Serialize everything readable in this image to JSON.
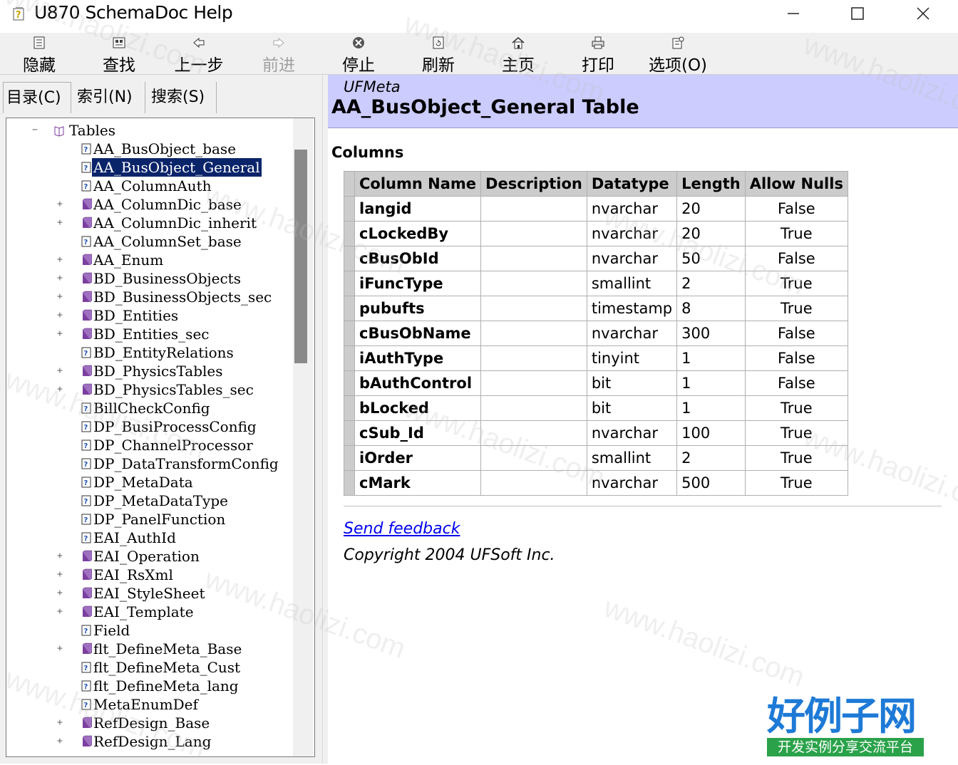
{
  "window": {
    "title": "U870 SchemaDoc Help"
  },
  "toolbar": {
    "items": [
      {
        "label": "隐藏",
        "icon": "hide-icon",
        "enabled": true
      },
      {
        "label": "查找",
        "icon": "find-icon",
        "enabled": true
      },
      {
        "label": "上一步",
        "icon": "back-arrow-icon",
        "enabled": true
      },
      {
        "label": "前进",
        "icon": "forward-arrow-icon",
        "enabled": false
      },
      {
        "label": "停止",
        "icon": "stop-icon",
        "enabled": true
      },
      {
        "label": "刷新",
        "icon": "refresh-icon",
        "enabled": true
      },
      {
        "label": "主页",
        "icon": "home-icon",
        "enabled": true
      },
      {
        "label": "打印",
        "icon": "print-icon",
        "enabled": true
      },
      {
        "label": "选项(O)",
        "icon": "options-icon",
        "enabled": true
      }
    ]
  },
  "nav_tabs": [
    {
      "label": "目录(C)",
      "active": true
    },
    {
      "label": "索引(N)",
      "active": false
    },
    {
      "label": "搜索(S)",
      "active": false
    }
  ],
  "tree": {
    "root": "Tables",
    "items": [
      {
        "label": "AA_BusObject_base",
        "kind": "page",
        "expandable": false,
        "selected": false
      },
      {
        "label": "AA_BusObject_General",
        "kind": "page",
        "expandable": false,
        "selected": true
      },
      {
        "label": "AA_ColumnAuth",
        "kind": "page",
        "expandable": false,
        "selected": false
      },
      {
        "label": "AA_ColumnDic_base",
        "kind": "book",
        "expandable": true,
        "selected": false
      },
      {
        "label": "AA_ColumnDic_inherit",
        "kind": "book",
        "expandable": true,
        "selected": false
      },
      {
        "label": "AA_ColumnSet_base",
        "kind": "page",
        "expandable": false,
        "selected": false
      },
      {
        "label": "AA_Enum",
        "kind": "book",
        "expandable": true,
        "selected": false
      },
      {
        "label": "BD_BusinessObjects",
        "kind": "book",
        "expandable": true,
        "selected": false
      },
      {
        "label": "BD_BusinessObjects_sec",
        "kind": "book",
        "expandable": true,
        "selected": false
      },
      {
        "label": "BD_Entities",
        "kind": "book",
        "expandable": true,
        "selected": false
      },
      {
        "label": "BD_Entities_sec",
        "kind": "book",
        "expandable": true,
        "selected": false
      },
      {
        "label": "BD_EntityRelations",
        "kind": "page",
        "expandable": false,
        "selected": false
      },
      {
        "label": "BD_PhysicsTables",
        "kind": "book",
        "expandable": true,
        "selected": false
      },
      {
        "label": "BD_PhysicsTables_sec",
        "kind": "book",
        "expandable": true,
        "selected": false
      },
      {
        "label": "BillCheckConfig",
        "kind": "page",
        "expandable": false,
        "selected": false
      },
      {
        "label": "DP_BusiProcessConfig",
        "kind": "page",
        "expandable": false,
        "selected": false
      },
      {
        "label": "DP_ChannelProcessor",
        "kind": "page",
        "expandable": false,
        "selected": false
      },
      {
        "label": "DP_DataTransformConfig",
        "kind": "page",
        "expandable": false,
        "selected": false
      },
      {
        "label": "DP_MetaData",
        "kind": "page",
        "expandable": false,
        "selected": false
      },
      {
        "label": "DP_MetaDataType",
        "kind": "page",
        "expandable": false,
        "selected": false
      },
      {
        "label": "DP_PanelFunction",
        "kind": "page",
        "expandable": false,
        "selected": false
      },
      {
        "label": "EAI_AuthId",
        "kind": "page",
        "expandable": false,
        "selected": false
      },
      {
        "label": "EAI_Operation",
        "kind": "book",
        "expandable": true,
        "selected": false
      },
      {
        "label": "EAI_RsXml",
        "kind": "book",
        "expandable": true,
        "selected": false
      },
      {
        "label": "EAI_StyleSheet",
        "kind": "book",
        "expandable": true,
        "selected": false
      },
      {
        "label": "EAI_Template",
        "kind": "book",
        "expandable": true,
        "selected": false
      },
      {
        "label": "Field",
        "kind": "page",
        "expandable": false,
        "selected": false
      },
      {
        "label": "flt_DefineMeta_Base",
        "kind": "book",
        "expandable": true,
        "selected": false
      },
      {
        "label": "flt_DefineMeta_Cust",
        "kind": "page",
        "expandable": false,
        "selected": false
      },
      {
        "label": "flt_DefineMeta_lang",
        "kind": "page",
        "expandable": false,
        "selected": false
      },
      {
        "label": "MetaEnumDef",
        "kind": "page",
        "expandable": false,
        "selected": false
      },
      {
        "label": "RefDesign_Base",
        "kind": "book",
        "expandable": true,
        "selected": false
      },
      {
        "label": "RefDesign_Lang",
        "kind": "book",
        "expandable": true,
        "selected": false
      }
    ]
  },
  "page": {
    "subtitle": "UFMeta",
    "title": "AA_BusObject_General Table",
    "section": "Columns",
    "table": {
      "headers": [
        "Column Name",
        "Description",
        "Datatype",
        "Length",
        "Allow Nulls"
      ],
      "rows": [
        [
          "langid",
          "",
          "nvarchar",
          "20",
          "False"
        ],
        [
          "cLockedBy",
          "",
          "nvarchar",
          "20",
          "True"
        ],
        [
          "cBusObId",
          "",
          "nvarchar",
          "50",
          "False"
        ],
        [
          "iFuncType",
          "",
          "smallint",
          "2",
          "True"
        ],
        [
          "pubufts",
          "",
          "timestamp",
          "8",
          "True"
        ],
        [
          "cBusObName",
          "",
          "nvarchar",
          "300",
          "False"
        ],
        [
          "iAuthType",
          "",
          "tinyint",
          "1",
          "False"
        ],
        [
          "bAuthControl",
          "",
          "bit",
          "1",
          "False"
        ],
        [
          "bLocked",
          "",
          "bit",
          "1",
          "True"
        ],
        [
          "cSub_Id",
          "",
          "nvarchar",
          "100",
          "True"
        ],
        [
          "iOrder",
          "",
          "smallint",
          "2",
          "True"
        ],
        [
          "cMark",
          "",
          "nvarchar",
          "500",
          "True"
        ]
      ]
    },
    "feedback_link": "Send feedback",
    "copyright": "Copyright 2004 UFSoft Inc."
  },
  "watermark": {
    "text": "www.haolizi.com",
    "logo_title": "好例子网",
    "logo_tagline": "开发实例分享交流平台"
  },
  "colors": {
    "banner": "#ccccff",
    "selection": "#0a246a",
    "link": "#0000ee",
    "book_icon": "#7b3fa0"
  }
}
